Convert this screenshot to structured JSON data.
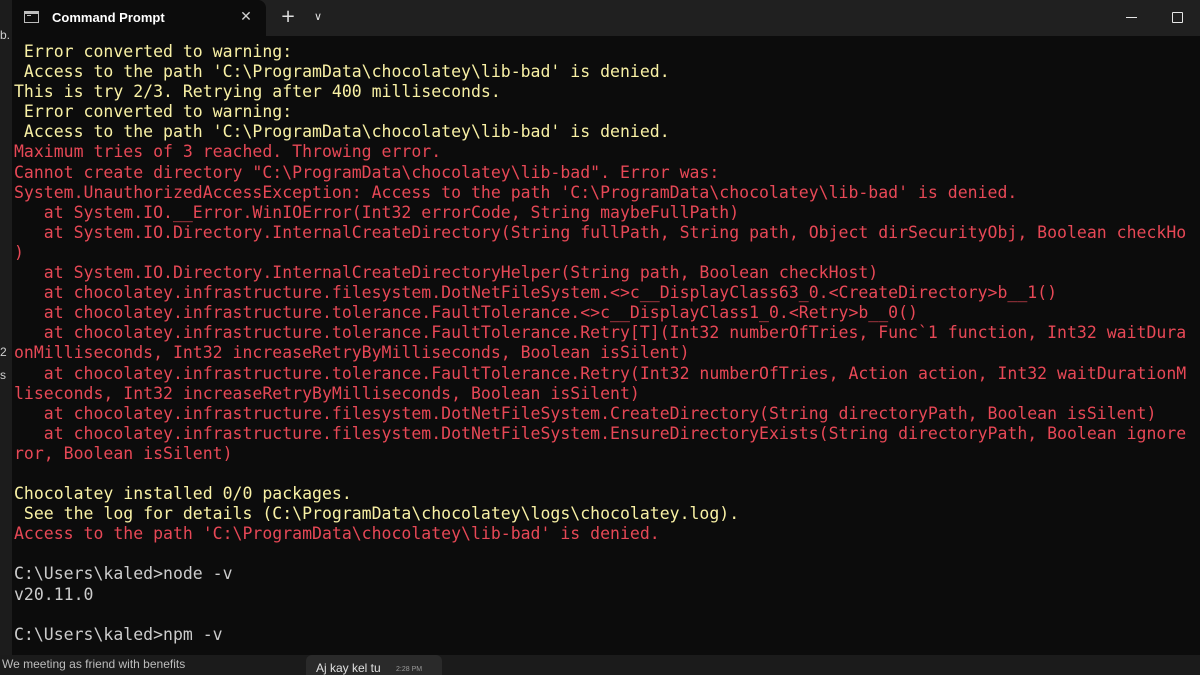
{
  "window": {
    "tab_title": "Command Prompt"
  },
  "background": {
    "fragments": [
      "b.",
      "2",
      "s"
    ],
    "bottom_text": "We meeting as friend with benefits",
    "chat_message": "Aj kay kel tu",
    "chat_time": "2:28 PM"
  },
  "colors": {
    "yellow": "#f9f1a5",
    "red": "#e74856",
    "white": "#cccccc",
    "background": "#0c0c0c"
  },
  "console": {
    "lines": [
      {
        "text": " Error converted to warning:",
        "color": "yellow"
      },
      {
        "text": " Access to the path 'C:\\ProgramData\\chocolatey\\lib-bad' is denied.",
        "color": "yellow"
      },
      {
        "text": "This is try 2/3. Retrying after 400 milliseconds.",
        "color": "yellow"
      },
      {
        "text": " Error converted to warning:",
        "color": "yellow"
      },
      {
        "text": " Access to the path 'C:\\ProgramData\\chocolatey\\lib-bad' is denied.",
        "color": "yellow"
      },
      {
        "text": "Maximum tries of 3 reached. Throwing error.",
        "color": "red"
      },
      {
        "text": "Cannot create directory \"C:\\ProgramData\\chocolatey\\lib-bad\". Error was:",
        "color": "red"
      },
      {
        "text": "System.UnauthorizedAccessException: Access to the path 'C:\\ProgramData\\chocolatey\\lib-bad' is denied.",
        "color": "red"
      },
      {
        "text": "   at System.IO.__Error.WinIOError(Int32 errorCode, String maybeFullPath)",
        "color": "red"
      },
      {
        "text": "   at System.IO.Directory.InternalCreateDirectory(String fullPath, String path, Object dirSecurityObj, Boolean checkHo",
        "color": "red"
      },
      {
        "text": ")",
        "color": "red"
      },
      {
        "text": "   at System.IO.Directory.InternalCreateDirectoryHelper(String path, Boolean checkHost)",
        "color": "red"
      },
      {
        "text": "   at chocolatey.infrastructure.filesystem.DotNetFileSystem.<>c__DisplayClass63_0.<CreateDirectory>b__1()",
        "color": "red"
      },
      {
        "text": "   at chocolatey.infrastructure.tolerance.FaultTolerance.<>c__DisplayClass1_0.<Retry>b__0()",
        "color": "red"
      },
      {
        "text": "   at chocolatey.infrastructure.tolerance.FaultTolerance.Retry[T](Int32 numberOfTries, Func`1 function, Int32 waitDura",
        "color": "red"
      },
      {
        "text": "onMilliseconds, Int32 increaseRetryByMilliseconds, Boolean isSilent)",
        "color": "red"
      },
      {
        "text": "   at chocolatey.infrastructure.tolerance.FaultTolerance.Retry(Int32 numberOfTries, Action action, Int32 waitDurationM",
        "color": "red"
      },
      {
        "text": "liseconds, Int32 increaseRetryByMilliseconds, Boolean isSilent)",
        "color": "red"
      },
      {
        "text": "   at chocolatey.infrastructure.filesystem.DotNetFileSystem.CreateDirectory(String directoryPath, Boolean isSilent)",
        "color": "red"
      },
      {
        "text": "   at chocolatey.infrastructure.filesystem.DotNetFileSystem.EnsureDirectoryExists(String directoryPath, Boolean ignore",
        "color": "red"
      },
      {
        "text": "ror, Boolean isSilent)",
        "color": "red"
      },
      {
        "text": "",
        "color": "white"
      },
      {
        "text": "Chocolatey installed 0/0 packages.",
        "color": "yellow"
      },
      {
        "text": " See the log for details (C:\\ProgramData\\chocolatey\\logs\\chocolatey.log).",
        "color": "yellow"
      },
      {
        "text": "Access to the path 'C:\\ProgramData\\chocolatey\\lib-bad' is denied.",
        "color": "red"
      },
      {
        "text": "",
        "color": "white"
      },
      {
        "text": "C:\\Users\\kaled>node -v",
        "color": "white"
      },
      {
        "text": "v20.11.0",
        "color": "white"
      },
      {
        "text": "",
        "color": "white"
      },
      {
        "text": "C:\\Users\\kaled>npm -v",
        "color": "white"
      }
    ]
  }
}
